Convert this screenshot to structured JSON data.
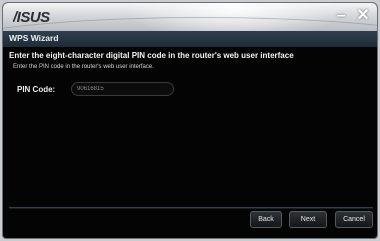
{
  "window": {
    "brand": "/ISUS",
    "controls": {
      "minimize": "–",
      "close": "✕"
    }
  },
  "header": {
    "title": "WPS Wizard"
  },
  "main": {
    "heading": "Enter the eight-character digital PIN code in the router's web user interface",
    "subtext": "Enter the PIN code in the router's web user interface.",
    "pin": {
      "label": "PIN Code:",
      "value": "90616815"
    }
  },
  "footer": {
    "back_label": "Back",
    "next_label": "Next",
    "cancel_label": "Cancel"
  },
  "colors": {
    "background": "#040404",
    "header_bar": "#2e3f4f",
    "titlebar": "#d5d8db",
    "text": "#f4f4f4"
  }
}
